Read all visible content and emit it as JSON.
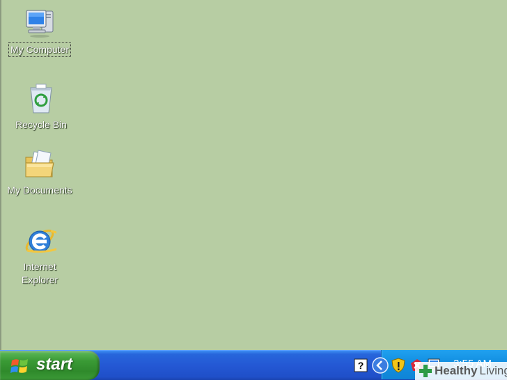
{
  "desktop": {
    "background_color": "#b7cda3",
    "icons": [
      {
        "name": "my-computer",
        "label": "My Computer",
        "icon": "computer-icon",
        "selected": true
      },
      {
        "name": "recycle-bin",
        "label": "Recycle Bin",
        "icon": "recycle-bin-icon",
        "selected": false
      },
      {
        "name": "my-documents",
        "label": "My Documents",
        "icon": "documents-folder-icon",
        "selected": false
      },
      {
        "name": "internet-explorer",
        "label": "Internet\nExplorer",
        "icon": "internet-explorer-icon",
        "selected": false
      }
    ]
  },
  "taskbar": {
    "start_label": "start",
    "tray_icons": [
      "help-icon",
      "show-hidden-icons-chevron",
      "security-shield-icon",
      "alert-icon",
      "network-icon"
    ],
    "clock": "3:55 AM"
  },
  "watermark": {
    "brand_bold": "Healthy",
    "brand_regular": "Living",
    "accent_color": "#2e9b46"
  }
}
